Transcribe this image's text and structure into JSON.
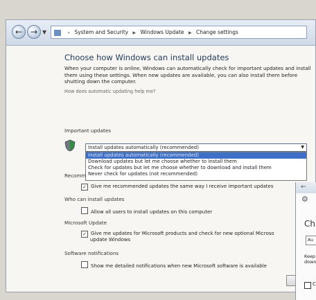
{
  "window": {
    "breadcrumb": [
      "System and Security",
      "Windows Update",
      "Change settings"
    ],
    "title": "Choose how Windows can install updates",
    "intro": "When your computer is online, Windows can automatically check for important updates and install them using these settings. When new updates are available, you can also install them before shutting down the computer.",
    "help_link": "How does automatic updating help me?"
  },
  "important_updates": {
    "heading": "Important updates",
    "selected": "Install updates automatically (recommended)",
    "options": [
      "Install updates automatically (recommended)",
      "Download updates but let me choose whether to install them",
      "Check for updates but let me choose whether to download and install them",
      "Never check for updates (not recommended)"
    ]
  },
  "recommended_updates": {
    "heading": "Recomm",
    "checkbox": "Give me recommended updates the same way I receive important updates",
    "checked": true
  },
  "who_can_install": {
    "heading": "Who can install updates",
    "checkbox": "Allow all users to install updates on this computer",
    "checked": false
  },
  "microsoft_update": {
    "heading": "Microsoft Update",
    "checkbox_line1": "Give me updates for Microsoft products and check for new optional Microso",
    "checkbox_line2": "update Windows",
    "checked": true
  },
  "software_notifications": {
    "heading": "Software notifications",
    "checkbox": "Show me detailed notifications when new Microsoft software is available",
    "checked": false
  },
  "second_window": {
    "heading": "Ch",
    "box_text": "Au",
    "para_line1": "Keep",
    "para_line2": "down"
  }
}
